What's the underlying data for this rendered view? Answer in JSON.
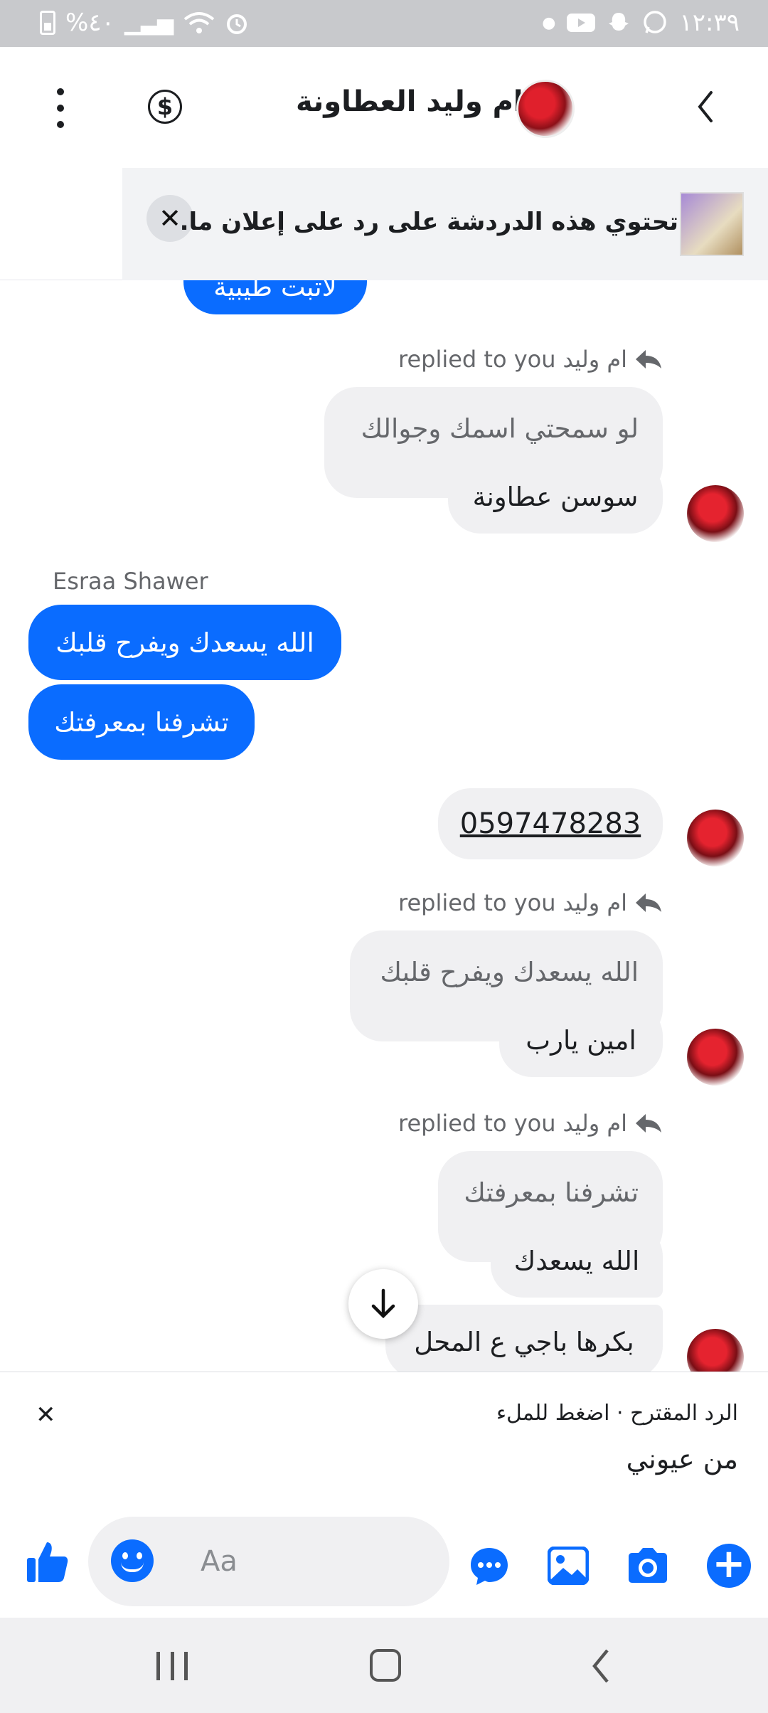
{
  "status_bar": {
    "time": "١٢:٣٩",
    "battery": "%٤٠"
  },
  "header": {
    "contact_name": "ام وليد العطاونة"
  },
  "ad_banner": {
    "text": "تحتوي هذه الدردشة على رد على إعلان ما."
  },
  "messages": {
    "partial_top": "لاتبت طيبية",
    "reply1": {
      "label_name": "ام وليد",
      "label_suffix": "replied to you",
      "quote": "لو سمحتي اسمك وجوالك",
      "text": "سوسن عطاونة"
    },
    "sender_name": "Esraa Shawer",
    "sent1": "الله يسعدك ويفرح قلبك",
    "sent2": "تشرفنا بمعرفتك",
    "phone": "0597478283",
    "reply2": {
      "label_name": "ام وليد",
      "label_suffix": "replied to you",
      "quote": "الله يسعدك ويفرح قلبك",
      "text": "امين يارب"
    },
    "reply3": {
      "label_name": "ام وليد",
      "label_suffix": "replied to you",
      "quote": "تشرفنا بمعرفتك",
      "text": "الله يسعدك",
      "extra": "بكرها باجي ع المحل"
    }
  },
  "suggested_reply": {
    "header": "الرد المقترح · اضغط للملء",
    "text": "من عيوني"
  },
  "composer": {
    "placeholder": "Aa"
  },
  "colors": {
    "accent": "#0a6cff",
    "bubble_gray": "#f0f0f2"
  },
  "icons": [
    "like-icon",
    "emoji-icon",
    "chat-bubble-icon",
    "gallery-icon",
    "camera-icon",
    "plus-icon",
    "dollar-icon",
    "more-vertical-icon",
    "back-chevron-icon",
    "close-icon",
    "arrow-down-icon",
    "reply-arrow-icon"
  ]
}
